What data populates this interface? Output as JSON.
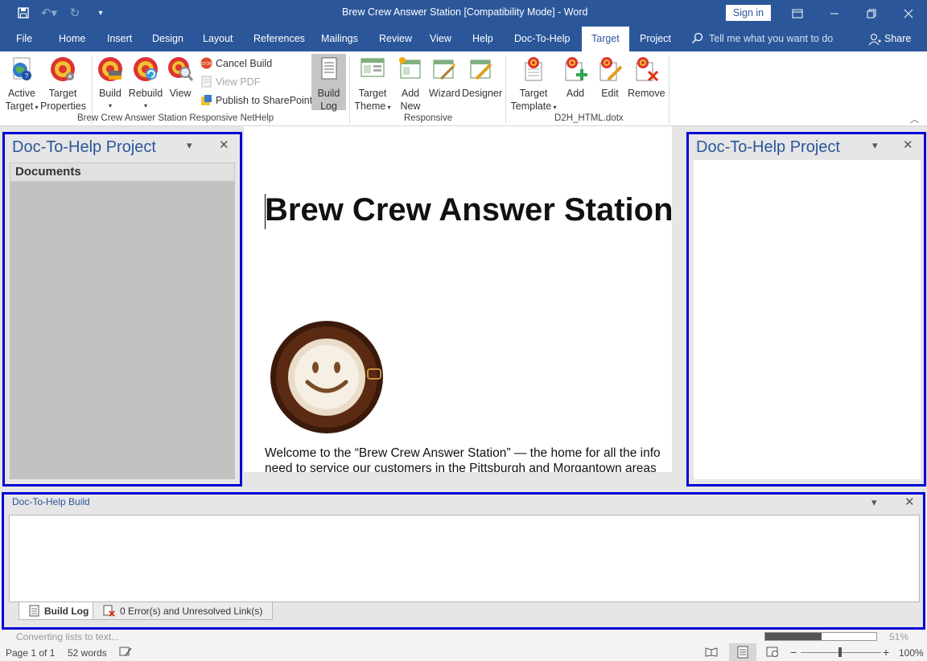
{
  "window": {
    "title": "Brew Crew Answer Station [Compatibility Mode]  -  Word",
    "signin": "Sign in"
  },
  "tabs": [
    "File",
    "Home",
    "Insert",
    "Design",
    "Layout",
    "References",
    "Mailings",
    "Review",
    "View",
    "Help",
    "Doc-To-Help",
    "Target",
    "Project"
  ],
  "active_tab": "Target",
  "tellme": "Tell me what you want to do",
  "share": "Share",
  "ribbon": {
    "active_target": [
      "Active",
      "Target"
    ],
    "target_properties": [
      "Target",
      "Properties"
    ],
    "build": "Build",
    "rebuild": "Rebuild",
    "view": "View",
    "cancel_build": "Cancel Build",
    "view_pdf": "View PDF",
    "publish": "Publish to SharePoint",
    "build_log": [
      "Build",
      "Log"
    ],
    "target_theme": [
      "Target",
      "Theme"
    ],
    "add_new": [
      "Add",
      "New"
    ],
    "wizard": "Wizard",
    "designer": "Designer",
    "target_template": [
      "Target",
      "Template"
    ],
    "add": "Add",
    "edit": "Edit",
    "remove": "Remove",
    "group1": "Brew Crew Answer Station Responsive NetHelp",
    "group2": "Responsive",
    "group3": "D2H_HTML.dotx"
  },
  "document": {
    "heading": "Brew Crew Answer Station",
    "para_line1": "Welcome to the “Brew Crew Answer Station” — the home for all the info",
    "para_line2": "need to service our customers in the Pittsburgh and Morgantown areas"
  },
  "left_pane": {
    "title": "Doc-To-Help Project",
    "section": "Documents"
  },
  "right_pane": {
    "title": "Doc-To-Help Project"
  },
  "build_pane": {
    "title": "Doc-To-Help Build",
    "tab_log": "Build Log",
    "tab_errors": "0 Error(s) and Unresolved Link(s)"
  },
  "status": {
    "progress_text": "Converting lists to text...",
    "progress_fraction": 0.51,
    "progress_pct": "51%",
    "page": "Page 1 of 1",
    "words": "52 words",
    "zoom": "100%"
  },
  "colors": {
    "accent": "#2b579a",
    "pane_border": "#0000d4"
  }
}
